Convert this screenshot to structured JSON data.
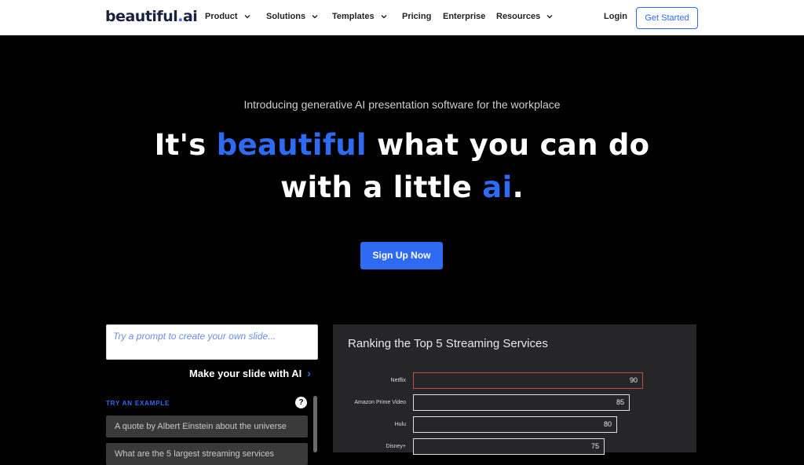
{
  "nav": {
    "logo_text": "beautiful",
    "logo_dot": ".",
    "logo_suffix": "ai",
    "items": [
      {
        "label": "Product",
        "dropdown": true
      },
      {
        "label": "Solutions",
        "dropdown": true
      },
      {
        "label": "Templates",
        "dropdown": true
      },
      {
        "label": "Pricing",
        "dropdown": false
      },
      {
        "label": "Enterprise",
        "dropdown": false
      },
      {
        "label": "Resources",
        "dropdown": true
      }
    ],
    "login": "Login",
    "get_started": "Get Started"
  },
  "hero": {
    "subtitle": "Introducing generative AI presentation software for the workplace",
    "line1_a": "It's ",
    "line1_b": "beautiful",
    "line1_c": " what you can do",
    "line2_a": "with a little ",
    "line2_b": "ai",
    "line2_c": ".",
    "signup": "Sign Up Now"
  },
  "prompt_panel": {
    "placeholder": "Try a prompt to create your own slide...",
    "make_label": "Make your slide with AI",
    "make_arrow": "›",
    "try_label": "TRY AN EXAMPLE",
    "help": "?",
    "examples": [
      "A quote by Albert Einstein about the universe",
      "What are the 5 largest streaming services"
    ]
  },
  "slide": {
    "title": "Ranking the Top 5 Streaming Services",
    "rows": [
      {
        "label": "Netflix",
        "value": "90"
      },
      {
        "label": "Amazon Prime Video",
        "value": "85"
      },
      {
        "label": "Hulu",
        "value": "80"
      },
      {
        "label": "Disney+",
        "value": "75"
      }
    ]
  },
  "colors": {
    "accent": "#2f6bf2",
    "background": "#000000",
    "slide_bg": "#262628",
    "highlight_border": "#c0503f"
  }
}
